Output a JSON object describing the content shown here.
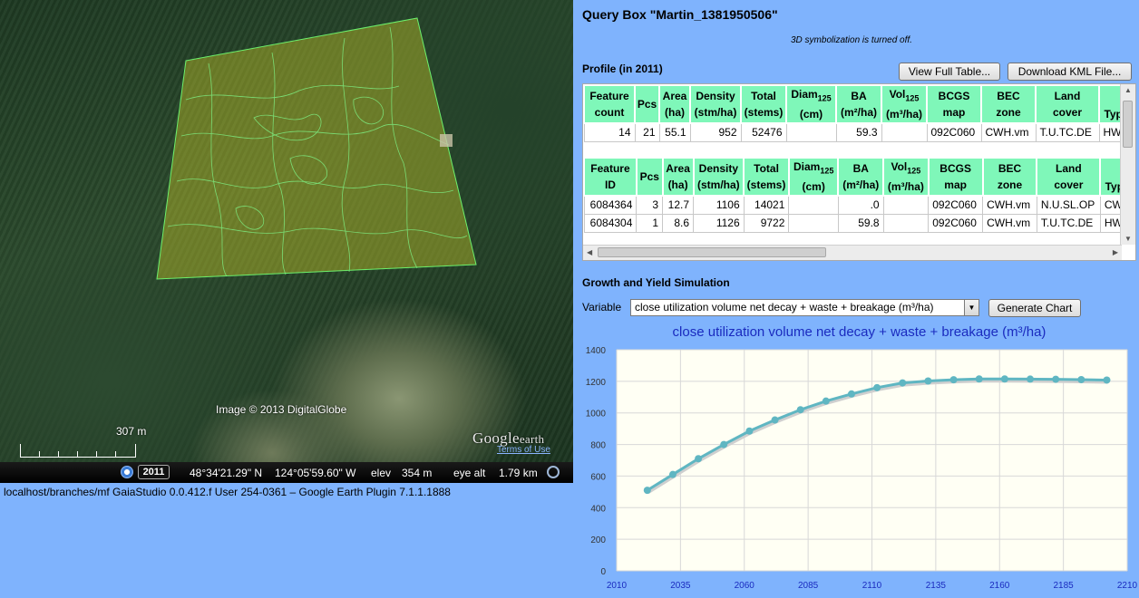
{
  "map": {
    "credit": "Image © 2013 DigitalGlobe",
    "scale_label": "307 m",
    "logo_main": "Google",
    "logo_sub": "earth",
    "terms": "Terms of Use",
    "status": {
      "year": "2011",
      "lat": "48°34'21.29\" N",
      "lon": "124°05'59.60\" W",
      "elev_label": "elev",
      "elev": "354 m",
      "eye_label": "eye alt",
      "eye": "1.79 km"
    }
  },
  "bottom_status": "localhost/branches/mf   GaiaStudio 0.0.412.f   User 254-0361   –   Google Earth Plugin 7.1.1.1888",
  "title": "Query Box \"Martin_1381950506\"",
  "note": "3D symbolization is turned off.",
  "profile": {
    "title": "Profile (in 2011)",
    "view_full_table": "View Full Table...",
    "download_kml": "Download KML File...",
    "summary_headers": {
      "c1": "Feature",
      "c1b": "count",
      "pcs": "Pcs",
      "area": "Area",
      "area_u": "(ha)",
      "density": "Density",
      "density_u": "(stm/ha)",
      "total": "Total",
      "total_u": "(stems)",
      "diam": "Diam",
      "diam_sub": "125",
      "diam_u": "(cm)",
      "ba": "BA",
      "ba_u": "(m²/ha)",
      "vol": "Vol",
      "vol_sub": "125",
      "vol_u": "(m³/ha)",
      "bcgs": "BCGS",
      "bcgs_u": "map",
      "bec": "BEC",
      "bec_u": "zone",
      "land": "Land",
      "land_u": "cover",
      "type": "Type"
    },
    "summary_row": [
      "14",
      "21",
      "55.1",
      "952",
      "52476",
      "",
      "59.3",
      "",
      "092C060",
      "CWH.vm",
      "T.U.TC.DE",
      "HW"
    ],
    "feature_headers": {
      "c1": "Feature",
      "c1b": "ID"
    },
    "feature_rows": [
      [
        "6084364",
        "3",
        "12.7",
        "1106",
        "14021",
        "",
        ".0",
        "",
        "092C060",
        "CWH.vm",
        "N.U.SL.OP",
        "CW"
      ],
      [
        "6084304",
        "1",
        "8.6",
        "1126",
        "9722",
        "",
        "59.8",
        "",
        "092C060",
        "CWH.vm",
        "T.U.TC.DE",
        "HW"
      ]
    ]
  },
  "growth": {
    "title": "Growth and Yield Simulation",
    "variable_label": "Variable",
    "variable_value": "close utilization volume net decay + waste + breakage (m³/ha)",
    "generate": "Generate Chart"
  },
  "chart_data": {
    "type": "line",
    "title": "close utilization volume net decay + waste + breakage (m³/ha)",
    "xlabel": "",
    "ylabel": "",
    "xlim": [
      2010,
      2210
    ],
    "ylim": [
      0,
      1400
    ],
    "xticks": [
      2010,
      2035,
      2060,
      2085,
      2110,
      2135,
      2160,
      2185,
      2210
    ],
    "yticks": [
      0,
      200,
      400,
      600,
      800,
      1000,
      1200,
      1400
    ],
    "grid": true,
    "series": [
      {
        "x": [
          2022,
          2032,
          2042,
          2052,
          2062,
          2072,
          2082,
          2092,
          2102,
          2112,
          2122,
          2132,
          2142,
          2152,
          2162,
          2172,
          2182,
          2192,
          2202
        ],
        "y": [
          510,
          610,
          710,
          800,
          885,
          955,
          1020,
          1075,
          1120,
          1160,
          1190,
          1202,
          1210,
          1215,
          1215,
          1214,
          1213,
          1211,
          1208
        ]
      }
    ],
    "colors": {
      "line": "#5fb6c2",
      "point": "#5fb6c2",
      "plot_bg": "#fffff4",
      "tick_text": "#1a2bbf"
    }
  }
}
